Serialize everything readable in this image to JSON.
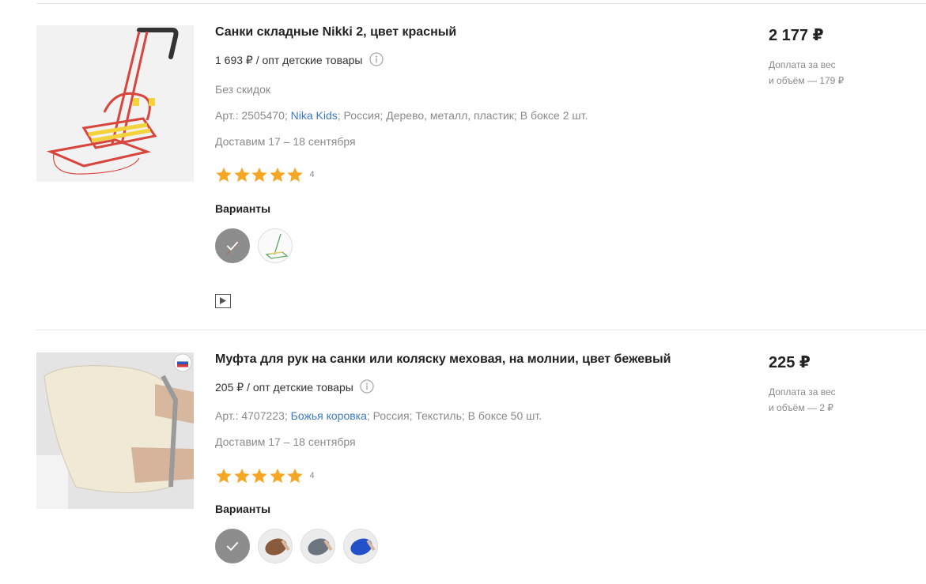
{
  "products": [
    {
      "title": "Санки складные Nikki 2, цвет красный",
      "opt_price": "1 693 ₽ / опт детские товары",
      "discount": "Без скидок",
      "article_prefix": "Арт.: 2505470;",
      "brand": "Nika Kids",
      "attributes": "; Россия; Дерево, металл, пластик; В боксе 2 шт.",
      "delivery": "Доставим 17 – 18 сентября",
      "rating": 5,
      "rating_count": "4",
      "variants_label": "Варианты",
      "price": "2 177 ₽",
      "surcharge_line1": "Доплата за вес",
      "surcharge_line2": "и объём — 179 ₽",
      "icons": {
        "info": "info-icon",
        "video": "play-video-icon",
        "star": "star-icon",
        "check": "check-icon"
      },
      "colors": {
        "star": "#f5a623",
        "link": "#3c7ac7",
        "sled": "#d8453d",
        "sled_accent": "#f3d23b"
      }
    },
    {
      "title": "Муфта для рук на санки или коляску меховая, на молнии, цвет бежевый",
      "opt_price": "205 ₽ / опт детские товары",
      "article_prefix": "Арт.: 4707223;",
      "brand": "Божья коровка",
      "attributes": "; Россия; Текстиль; В боксе 50 шт.",
      "delivery": "Доставим 17 – 18 сентября",
      "rating": 5,
      "rating_count": "4",
      "variants_label": "Варианты",
      "price": "225 ₽",
      "surcharge_line1": "Доплата за вес",
      "surcharge_line2": "и объём — 2 ₽",
      "icons": {
        "info": "info-icon",
        "star": "star-icon",
        "check": "check-icon",
        "badge": "russia-flag-badge-icon"
      },
      "colors": {
        "muff": "#efe9d6",
        "variant_brown": "#8a5a3c",
        "variant_grey": "#6c7480",
        "variant_blue": "#2351c9"
      }
    }
  ]
}
